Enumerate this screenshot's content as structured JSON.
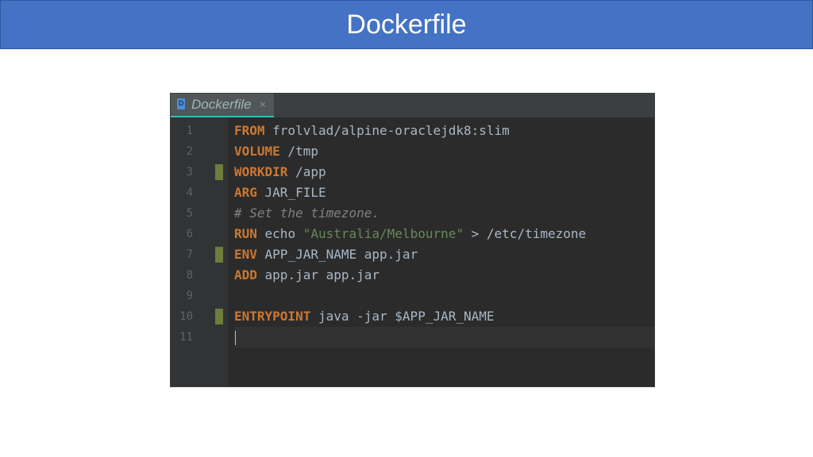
{
  "header": {
    "title": "Dockerfile"
  },
  "tab": {
    "name": "Dockerfile",
    "close": "×"
  },
  "gutter": {
    "lines": [
      "1",
      "2",
      "3",
      "4",
      "5",
      "6",
      "7",
      "8",
      "9",
      "10",
      "11"
    ],
    "markers": [
      false,
      false,
      true,
      false,
      false,
      false,
      true,
      false,
      false,
      true,
      false
    ]
  },
  "code": {
    "l1": {
      "kw": "FROM",
      "rest": " frolvlad/alpine-oraclejdk8:slim"
    },
    "l2": {
      "kw": "VOLUME",
      "rest": " /tmp"
    },
    "l3": {
      "kw": "WORKDIR",
      "rest": " /app"
    },
    "l4": {
      "kw": "ARG",
      "rest": " JAR_FILE"
    },
    "l5": {
      "cmt": "# Set the timezone."
    },
    "l6": {
      "kw": "RUN",
      "txt1": " echo ",
      "str": "\"Australia/Melbourne\"",
      "op": " > ",
      "txt2": "/etc/timezone"
    },
    "l7": {
      "kw": "ENV",
      "rest": " APP_JAR_NAME app.jar"
    },
    "l8": {
      "kw": "ADD",
      "rest": " app.jar app.jar"
    },
    "l9": {
      "blank": " "
    },
    "l10": {
      "kw": "ENTRYPOINT",
      "rest": " java -jar $APP_JAR_NAME"
    },
    "l11": {
      "blank": ""
    }
  }
}
